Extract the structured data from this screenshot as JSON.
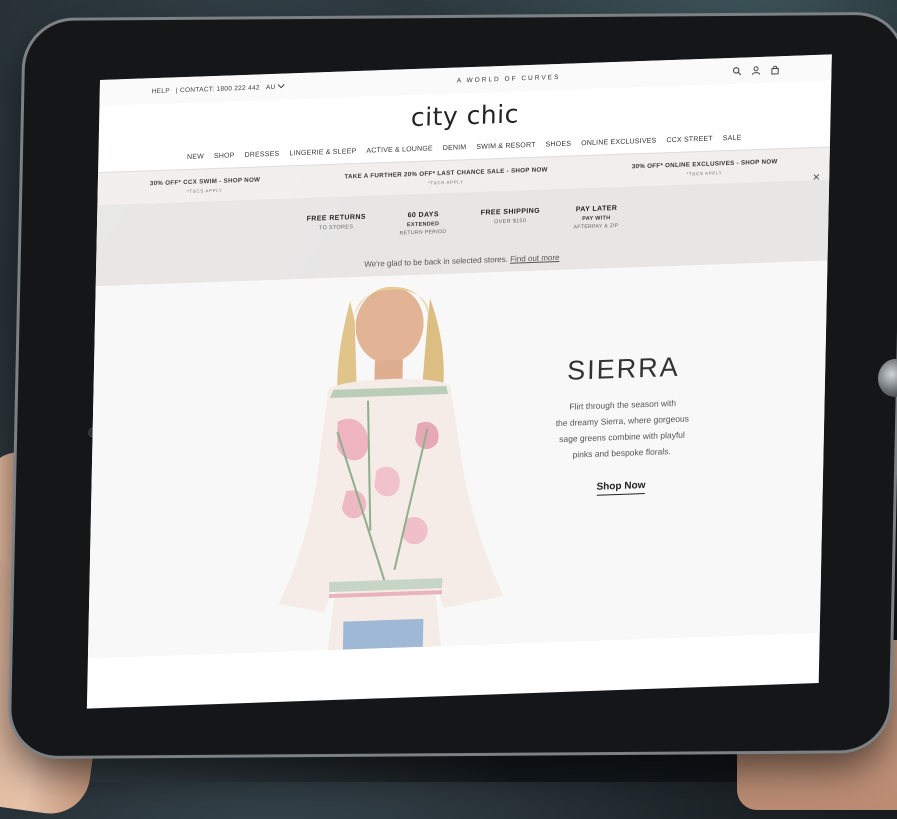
{
  "topbar": {
    "help": "HELP",
    "contact": "| CONTACT: 1800 222 442",
    "region": "AU",
    "tagline": "A WORLD OF CURVES"
  },
  "brand": {
    "logo": "city chic"
  },
  "nav": {
    "items": [
      "NEW",
      "SHOP",
      "DRESSES",
      "LINGERIE & SLEEP",
      "ACTIVE & LOUNGE",
      "DENIM",
      "SWIM & RESORT",
      "SHOES",
      "ONLINE EXCLUSIVES",
      "CCX STREET",
      "SALE"
    ]
  },
  "promos": [
    {
      "text": "30% OFF* CCX SWIM - SHOP NOW",
      "sub": "*T&CS APPLY"
    },
    {
      "text": "TAKE A FURTHER 20% OFF* LAST CHANCE SALE - SHOP NOW",
      "sub": "*T&CS APPLY"
    },
    {
      "text": "30% OFF* ONLINE EXCLUSIVES - SHOP NOW",
      "sub": "*T&CS APPLY"
    }
  ],
  "usps": [
    {
      "title": "FREE RETURNS",
      "line1": "TO STORES",
      "line2": ""
    },
    {
      "title": "60 DAYS",
      "line1": "EXTENDED",
      "line2": "RETURN PERIOD"
    },
    {
      "title": "FREE SHIPPING",
      "line1": "OVER $150",
      "line2": ""
    },
    {
      "title": "PAY LATER",
      "line1": "PAY WITH",
      "line2": "AFTERPAY & ZIP"
    }
  ],
  "notice": {
    "text": "We're glad to be back in selected stores.",
    "link": "Find out more"
  },
  "hero": {
    "title": "SIERRA",
    "line1": "Flirt through the season with",
    "line2": "the dreamy Sierra, where gorgeous",
    "line3": "sage greens combine with playful",
    "line4": "pinks and bespoke florals.",
    "cta": "Shop Now"
  },
  "icons": [
    "search-icon",
    "account-icon",
    "bag-icon",
    "chevron-down-icon",
    "close-icon"
  ],
  "colors": {
    "promo_bg": "#f1efed",
    "usp_bg": "#e7e6e5",
    "text": "#333333"
  }
}
